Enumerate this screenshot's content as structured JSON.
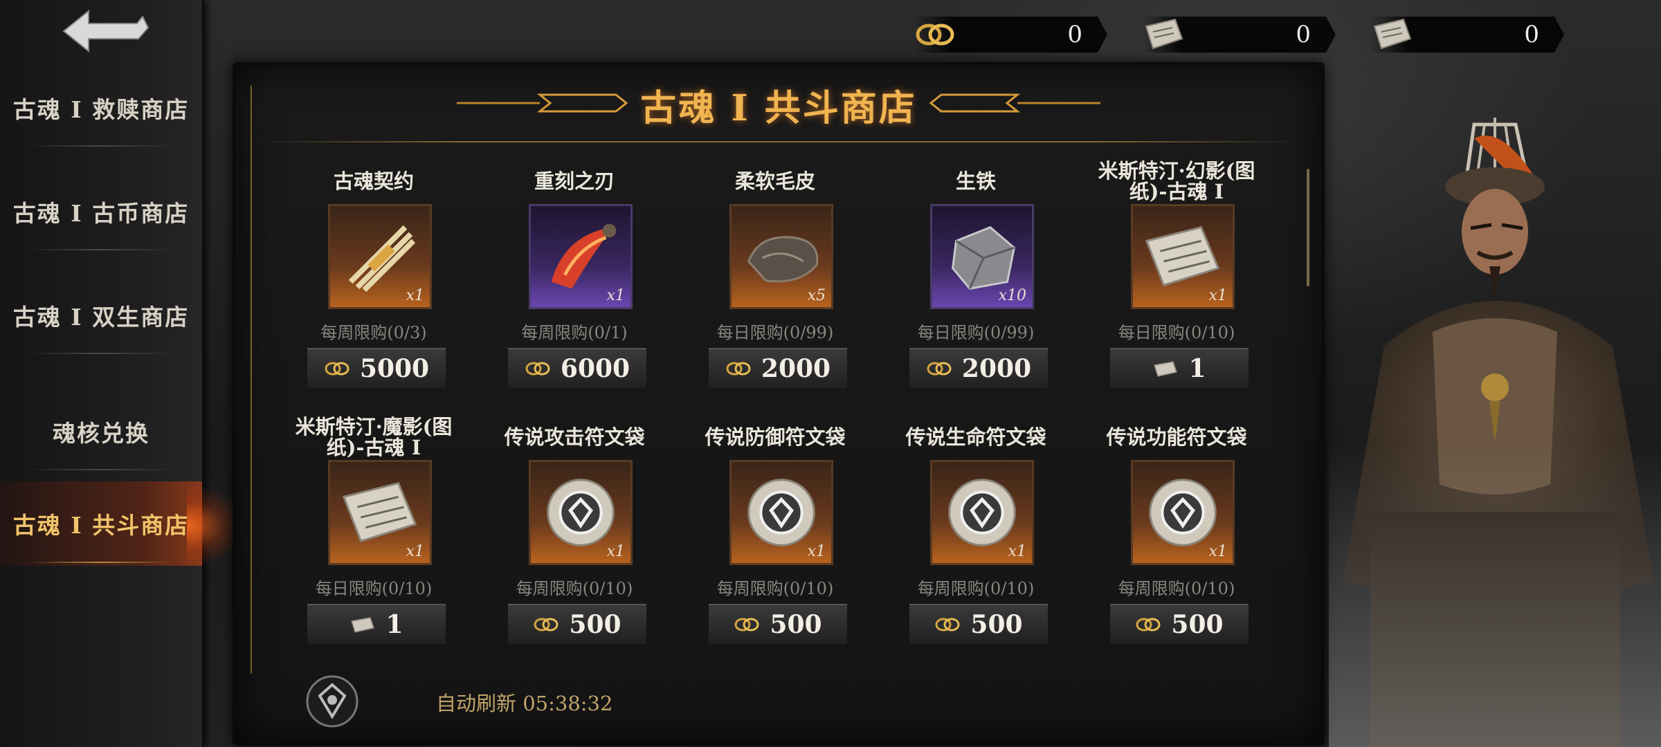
{
  "currencies": [
    {
      "icon": "soul-coin-icon",
      "value": "0"
    },
    {
      "icon": "blueprint-scroll-icon",
      "value": "0"
    },
    {
      "icon": "blueprint-scroll-icon",
      "value": "0"
    }
  ],
  "sidebar": {
    "items": [
      {
        "label": "古魂 I 救赎商店",
        "active": false
      },
      {
        "label": "古魂 I 古币商店",
        "active": false
      },
      {
        "label": "古魂 I 双生商店",
        "active": false
      },
      {
        "label": "魂核兑换",
        "active": false
      },
      {
        "label": "古魂 I 共斗商店",
        "active": true
      }
    ]
  },
  "panel": {
    "title": "古魂 I 共斗商店",
    "refresh": "自动刷新  05:38:32"
  },
  "items": [
    {
      "name": "古魂契约",
      "qty": "x1",
      "limit": "每周限购(0/3)",
      "price": "5000",
      "currency": "soul-coin-icon",
      "frame": "orange",
      "art": "sword-bundle-icon"
    },
    {
      "name": "重刻之刃",
      "qty": "x1",
      "limit": "每周限购(0/1)",
      "price": "6000",
      "currency": "soul-coin-icon",
      "frame": "purple",
      "art": "flaming-blade-icon"
    },
    {
      "name": "柔软毛皮",
      "qty": "x5",
      "limit": "每日限购(0/99)",
      "price": "2000",
      "currency": "soul-coin-icon",
      "frame": "orange",
      "art": "fur-pelt-icon"
    },
    {
      "name": "生铁",
      "qty": "x10",
      "limit": "每日限购(0/99)",
      "price": "2000",
      "currency": "soul-coin-icon",
      "frame": "purple",
      "art": "iron-ingot-icon"
    },
    {
      "name": "米斯特汀·幻影(图纸)-古魂 I",
      "qty": "x1",
      "limit": "每日限购(0/10)",
      "price": "1",
      "currency": "blueprint-scroll-icon",
      "frame": "orange",
      "art": "blueprint-scroll-icon"
    },
    {
      "name": "米斯特汀·魔影(图纸)-古魂 I",
      "qty": "x1",
      "limit": "每日限购(0/10)",
      "price": "1",
      "currency": "blueprint-scroll-icon",
      "frame": "orange",
      "art": "blueprint-scroll-icon"
    },
    {
      "name": "传说攻击符文袋",
      "qty": "x1",
      "limit": "每周限购(0/10)",
      "price": "500",
      "currency": "soul-coin-icon",
      "frame": "orange",
      "art": "rune-bag-icon"
    },
    {
      "name": "传说防御符文袋",
      "qty": "x1",
      "limit": "每周限购(0/10)",
      "price": "500",
      "currency": "soul-coin-icon",
      "frame": "orange",
      "art": "rune-bag-icon"
    },
    {
      "name": "传说生命符文袋",
      "qty": "x1",
      "limit": "每周限购(0/10)",
      "price": "500",
      "currency": "soul-coin-icon",
      "frame": "orange",
      "art": "rune-bag-icon"
    },
    {
      "name": "传说功能符文袋",
      "qty": "x1",
      "limit": "每周限购(0/10)",
      "price": "500",
      "currency": "soul-coin-icon",
      "frame": "orange",
      "art": "rune-bag-icon"
    }
  ],
  "colors": {
    "accent": "#f0b450",
    "active_tab": "#f0c46a",
    "frame_orange": "#b8621e",
    "frame_purple": "#6a46b0"
  }
}
